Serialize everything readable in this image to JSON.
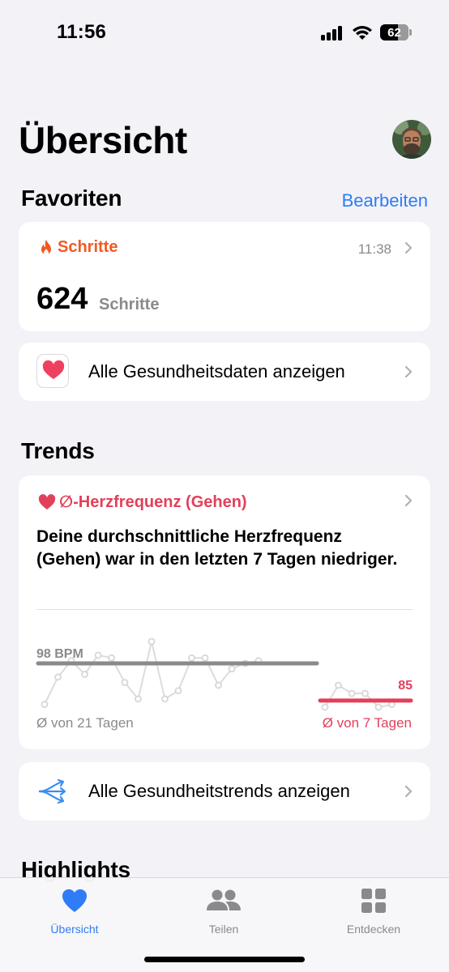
{
  "status_bar": {
    "time": "11:56",
    "battery": "62"
  },
  "header": {
    "title": "Übersicht"
  },
  "favorites": {
    "title": "Favoriten",
    "edit_label": "Bearbeiten",
    "steps_card": {
      "title": "Schritte",
      "time": "11:38",
      "value": "624",
      "unit": "Schritte"
    },
    "all_data_label": "Alle Gesundheitsdaten anzeigen"
  },
  "trends": {
    "title": "Trends",
    "card": {
      "title": "∅-Herzfrequenz (Gehen)",
      "description": "Deine durchschnittliche Herzfrequenz (Gehen) war in den letzten 7 Tagen niedriger.",
      "left_value_label": "98 BPM",
      "right_value_label": "85",
      "left_caption": "Ø von 21 Tagen",
      "right_caption": "Ø von 7 Tagen"
    },
    "all_trends_label": "Alle Gesundheitstrends anzeigen"
  },
  "highlights": {
    "title": "Highlights"
  },
  "tab_bar": {
    "tabs": [
      {
        "label": "Übersicht",
        "icon": "heart-icon",
        "active": true
      },
      {
        "label": "Teilen",
        "icon": "people-icon",
        "active": false
      },
      {
        "label": "Entdecken",
        "icon": "grid-icon",
        "active": false
      }
    ]
  },
  "colors": {
    "accent": "#2f7cf6",
    "steps": "#f05a22",
    "heart": "#e2405a",
    "gray_line": "#8a8a8a"
  },
  "chart_data": {
    "type": "line",
    "series": [
      {
        "values": [
          83,
          93,
          99,
          94,
          101,
          100,
          91,
          85,
          106,
          85,
          88,
          100,
          100,
          90,
          96,
          98,
          99
        ]
      },
      {
        "values": [
          82,
          90,
          87,
          87,
          82,
          83
        ]
      }
    ],
    "averages": [
      {
        "label": "98 BPM",
        "value": 98
      },
      {
        "label": "85",
        "value": 85
      }
    ]
  }
}
